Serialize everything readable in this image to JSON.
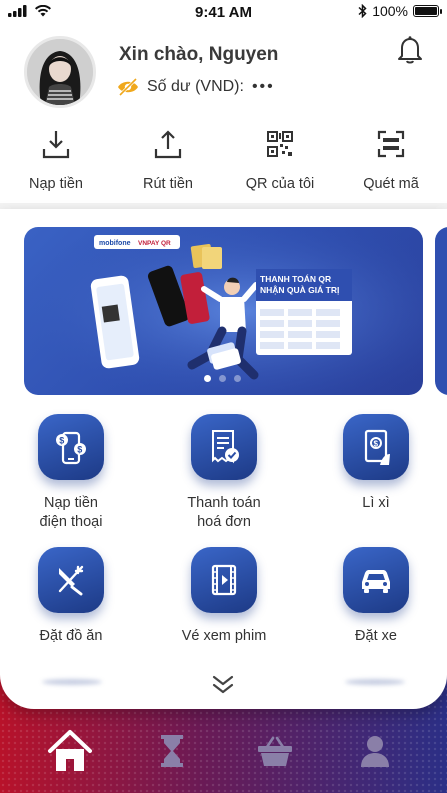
{
  "status": {
    "time": "9:41 AM",
    "battery": "100%"
  },
  "user": {
    "greeting": "Xin chào, Nguyen",
    "balance_label": "Số dư (VND):",
    "balance_mask": "•••"
  },
  "quick_actions": [
    {
      "label": "Nạp tiền",
      "icon": "download-icon"
    },
    {
      "label": "Rút tiền",
      "icon": "upload-icon"
    },
    {
      "label": "QR của tôi",
      "icon": "qr-code-icon"
    },
    {
      "label": "Quét mã",
      "icon": "scan-icon"
    }
  ],
  "banner": {
    "brand_1": "mobifone",
    "brand_2": "VNPAY QR",
    "headline_1": "THANH TOÁN QR",
    "headline_2": "NHẬN QUÀ GIÁ TRỊ",
    "slide_count": 3,
    "active_slide": 1
  },
  "services": [
    {
      "label_1": "Nạp tiền",
      "label_2": "điện thoại",
      "icon": "phone-topup-icon"
    },
    {
      "label_1": "Thanh toán",
      "label_2": "hoá đơn",
      "icon": "bill-icon"
    },
    {
      "label_1": "Lì xì",
      "label_2": "",
      "icon": "lucky-money-icon"
    },
    {
      "label_1": "Đặt đồ ăn",
      "label_2": "",
      "icon": "food-icon"
    },
    {
      "label_1": "Vé xem phim",
      "label_2": "",
      "icon": "film-icon"
    },
    {
      "label_1": "Đặt xe",
      "label_2": "",
      "icon": "car-icon"
    }
  ],
  "nav": [
    {
      "name": "home",
      "icon": "home-icon",
      "active": true
    },
    {
      "name": "history",
      "icon": "hourglass-icon",
      "active": false
    },
    {
      "name": "shop",
      "icon": "basket-icon",
      "active": false
    },
    {
      "name": "account",
      "icon": "user-icon",
      "active": false
    }
  ],
  "colors": {
    "primary": "#2f4fb0",
    "tile_dark": "#1d3a86",
    "eye_icon": "#f0a81c",
    "nav_gradient_start": "#b8122a",
    "nav_gradient_end": "#2b2f86"
  }
}
